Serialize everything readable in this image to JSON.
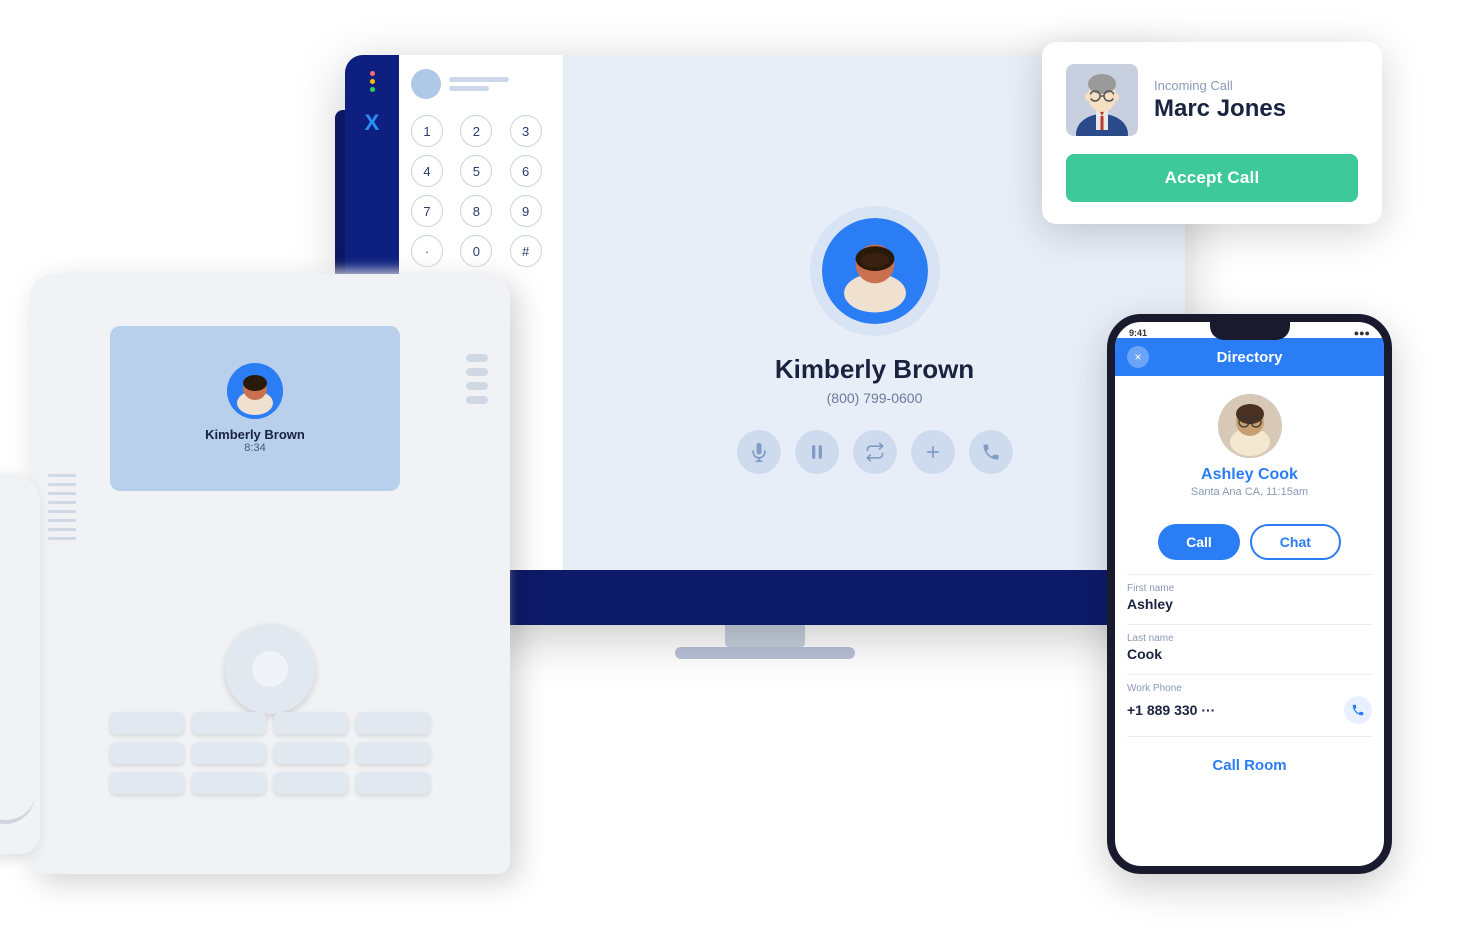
{
  "scene": {
    "background": "#ffffff"
  },
  "incoming_call": {
    "label": "Incoming Call",
    "caller_name": "Marc Jones",
    "accept_btn": "Accept Call"
  },
  "desktop_app": {
    "logo": "X",
    "dialpad_keys": [
      "1",
      "2",
      "3",
      "4",
      "5",
      "6",
      "7",
      "8",
      "9",
      ".",
      "0",
      "#"
    ],
    "contact_name": "Kimberly Brown",
    "contact_phone": "(800) 799-0600"
  },
  "desk_phone": {
    "contact_name": "Kimberly Brown",
    "contact_time": "8:34"
  },
  "mobile_directory": {
    "header_title": "Directory",
    "close_x": "×",
    "status_left": "9:41",
    "status_right": "●●●",
    "contact_name": "Ashley Cook",
    "contact_location": "Santa Ana CA, 11:15am",
    "call_btn": "Call",
    "chat_btn": "Chat",
    "first_name_label": "First name",
    "first_name": "Ashley",
    "last_name_label": "Last name",
    "last_name": "Cook",
    "work_phone_label": "Work Phone",
    "work_phone": "+1 889 330 ···",
    "call_room_btn": "Call Room"
  }
}
